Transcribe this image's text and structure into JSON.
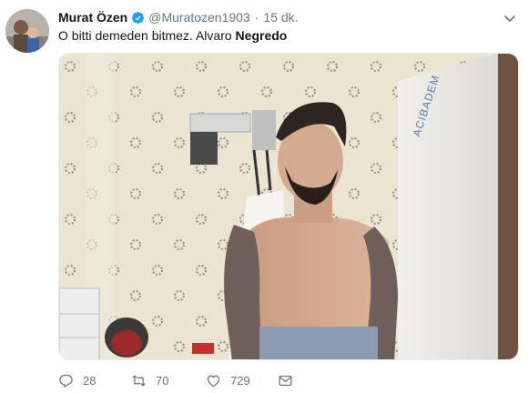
{
  "tweet": {
    "author_name": "Murat Özen",
    "handle": "@Muratozen1903",
    "separator": "·",
    "time": "15 dk.",
    "text_plain": "O bitti demeden bitmez. Alvaro ",
    "text_bold": "Negredo",
    "media_wall_text": "ACIBADEM"
  },
  "actions": {
    "replies": "28",
    "retweets": "70",
    "likes": "729"
  },
  "icons": {
    "verified": "verified-badge-icon",
    "caret": "chevron-down-icon",
    "reply": "reply-icon",
    "retweet": "retweet-icon",
    "like": "heart-icon",
    "dm": "direct-message-icon"
  },
  "colors": {
    "verified_blue": "#1da1f2",
    "muted_gray": "#657786",
    "text_dark": "#14171a"
  }
}
